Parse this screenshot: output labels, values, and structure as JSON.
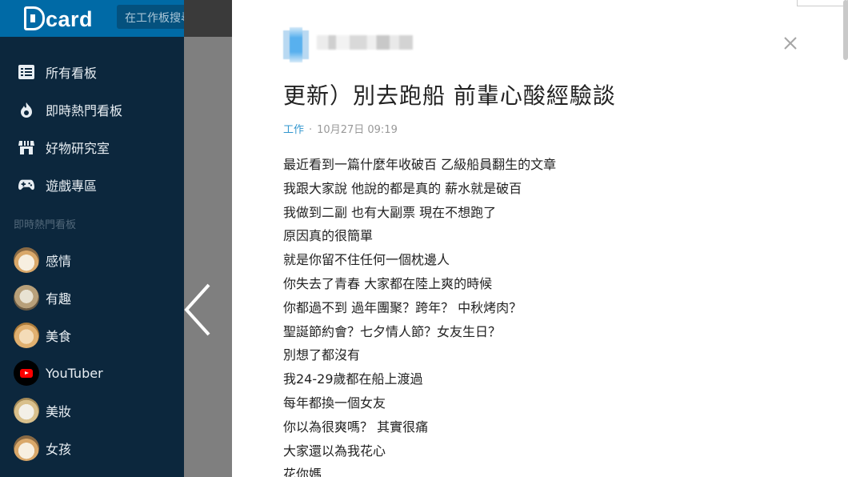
{
  "header": {
    "logo_text": "card",
    "search_placeholder": "在工作板搜尋"
  },
  "sidebar": {
    "nav": [
      {
        "label": "所有看板",
        "icon": "list-icon"
      },
      {
        "label": "即時熱門看板",
        "icon": "flame-icon"
      },
      {
        "label": "好物研究室",
        "icon": "store-icon"
      },
      {
        "label": "遊戲專區",
        "icon": "gamepad-icon"
      }
    ],
    "hot_heading": "即時熱門看板",
    "hot_boards": [
      {
        "label": "感情",
        "icon": "dog-avatar-icon"
      },
      {
        "label": "有趣",
        "icon": "dog-avatar-icon"
      },
      {
        "label": "美食",
        "icon": "dog-avatar-icon"
      },
      {
        "label": "YouTuber",
        "icon": "youtube-icon"
      },
      {
        "label": "美妝",
        "icon": "dog-avatar-icon"
      },
      {
        "label": "女孩",
        "icon": "dog-avatar-icon"
      }
    ]
  },
  "article": {
    "title": "更新）別去跑船 前輩心酸經驗談",
    "board": "工作",
    "separator": "·",
    "timestamp": "10月27日 09:19",
    "lines": [
      "最近看到一篇什麼年收破百 乙級船員翻生的文章",
      "我跟大家說 他說的都是真的 薪水就是破百",
      "我做到二副 也有大副票 現在不想跑了",
      "原因真的很簡單",
      "就是你留不住任何一個枕邊人",
      "你失去了青春 大家都在陸上爽的時候",
      "你都過不到 過年團聚？跨年？ 中秋烤肉？",
      "聖誕節約會？七夕情人節？女友生日？",
      "別想了都沒有",
      "我24-29歲都在船上渡過",
      "每年都換一個女友",
      "你以為很爽嗎？ 其實很痛",
      "大家還以為我花心",
      "花你媽"
    ]
  },
  "colors": {
    "brand": "#006aa6",
    "sidebar": "#0c273d",
    "link": "#3397cf"
  }
}
